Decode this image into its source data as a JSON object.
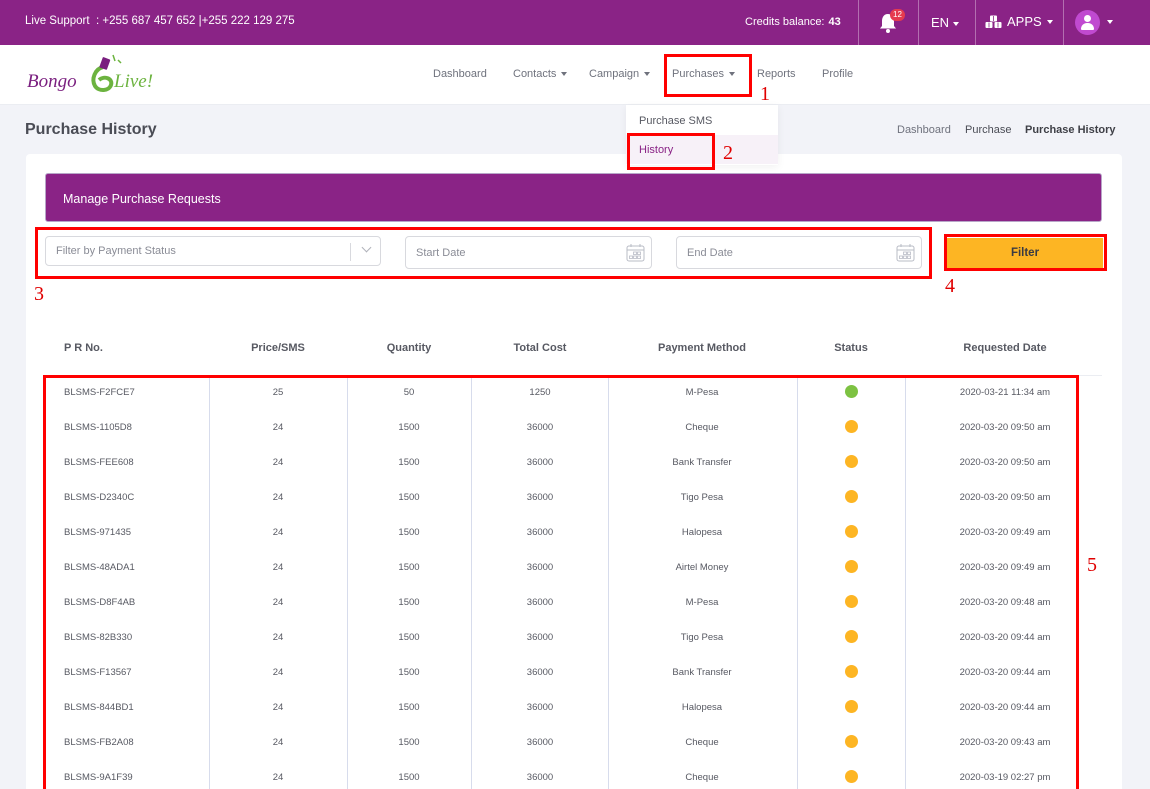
{
  "topbar": {
    "support_label": "Live Support",
    "support_phones": "+255 687 457 652 |+255 222 129 275",
    "credits_label": "Credits balance:",
    "credits_value": "43",
    "notification_count": "12",
    "language": "EN",
    "apps_label": "APPS"
  },
  "brand": {
    "name": "Bongo Live!",
    "part1": "Bongo",
    "part2": "Live!"
  },
  "nav": {
    "items": [
      {
        "label": "Dashboard"
      },
      {
        "label": "Contacts"
      },
      {
        "label": "Campaign"
      },
      {
        "label": "Purchases"
      },
      {
        "label": "Reports"
      },
      {
        "label": "Profile"
      }
    ],
    "purchases_menu": [
      {
        "label": "Purchase SMS"
      },
      {
        "label": "History"
      }
    ]
  },
  "page": {
    "title": "Purchase History",
    "breadcrumb": [
      "Dashboard",
      "Purchase",
      "Purchase History"
    ]
  },
  "card": {
    "title": "Manage Purchase Requests",
    "filters": {
      "status_placeholder": "Filter by Payment Status",
      "start_placeholder": "Start Date",
      "end_placeholder": "End Date",
      "filter_label": "Filter"
    }
  },
  "annotations": [
    "1",
    "2",
    "3",
    "4",
    "5"
  ],
  "colors": {
    "brand": "#8a2386",
    "accent": "#fdb523",
    "status_complete": "#7dc242",
    "status_pending": "#fdb523",
    "annotation": "#ff0000"
  },
  "table": {
    "headers": [
      "P R No.",
      "Price/SMS",
      "Quantity",
      "Total Cost",
      "Payment Method",
      "Status",
      "Requested Date"
    ],
    "rows": [
      {
        "pr": "BLSMS-F2FCE7",
        "price": "25",
        "qty": "50",
        "total": "1250",
        "method": "M-Pesa",
        "status": "complete",
        "date": "2020-03-21 11:34 am"
      },
      {
        "pr": "BLSMS-1105D8",
        "price": "24",
        "qty": "1500",
        "total": "36000",
        "method": "Cheque",
        "status": "pending",
        "date": "2020-03-20 09:50 am"
      },
      {
        "pr": "BLSMS-FEE608",
        "price": "24",
        "qty": "1500",
        "total": "36000",
        "method": "Bank Transfer",
        "status": "pending",
        "date": "2020-03-20 09:50 am"
      },
      {
        "pr": "BLSMS-D2340C",
        "price": "24",
        "qty": "1500",
        "total": "36000",
        "method": "Tigo Pesa",
        "status": "pending",
        "date": "2020-03-20 09:50 am"
      },
      {
        "pr": "BLSMS-971435",
        "price": "24",
        "qty": "1500",
        "total": "36000",
        "method": "Halopesa",
        "status": "pending",
        "date": "2020-03-20 09:49 am"
      },
      {
        "pr": "BLSMS-48ADA1",
        "price": "24",
        "qty": "1500",
        "total": "36000",
        "method": "Airtel Money",
        "status": "pending",
        "date": "2020-03-20 09:49 am"
      },
      {
        "pr": "BLSMS-D8F4AB",
        "price": "24",
        "qty": "1500",
        "total": "36000",
        "method": "M-Pesa",
        "status": "pending",
        "date": "2020-03-20 09:48 am"
      },
      {
        "pr": "BLSMS-82B330",
        "price": "24",
        "qty": "1500",
        "total": "36000",
        "method": "Tigo Pesa",
        "status": "pending",
        "date": "2020-03-20 09:44 am"
      },
      {
        "pr": "BLSMS-F13567",
        "price": "24",
        "qty": "1500",
        "total": "36000",
        "method": "Bank Transfer",
        "status": "pending",
        "date": "2020-03-20 09:44 am"
      },
      {
        "pr": "BLSMS-844BD1",
        "price": "24",
        "qty": "1500",
        "total": "36000",
        "method": "Halopesa",
        "status": "pending",
        "date": "2020-03-20 09:44 am"
      },
      {
        "pr": "BLSMS-FB2A08",
        "price": "24",
        "qty": "1500",
        "total": "36000",
        "method": "Cheque",
        "status": "pending",
        "date": "2020-03-20 09:43 am"
      },
      {
        "pr": "BLSMS-9A1F39",
        "price": "24",
        "qty": "1500",
        "total": "36000",
        "method": "Cheque",
        "status": "pending",
        "date": "2020-03-19 02:27 pm"
      }
    ]
  }
}
